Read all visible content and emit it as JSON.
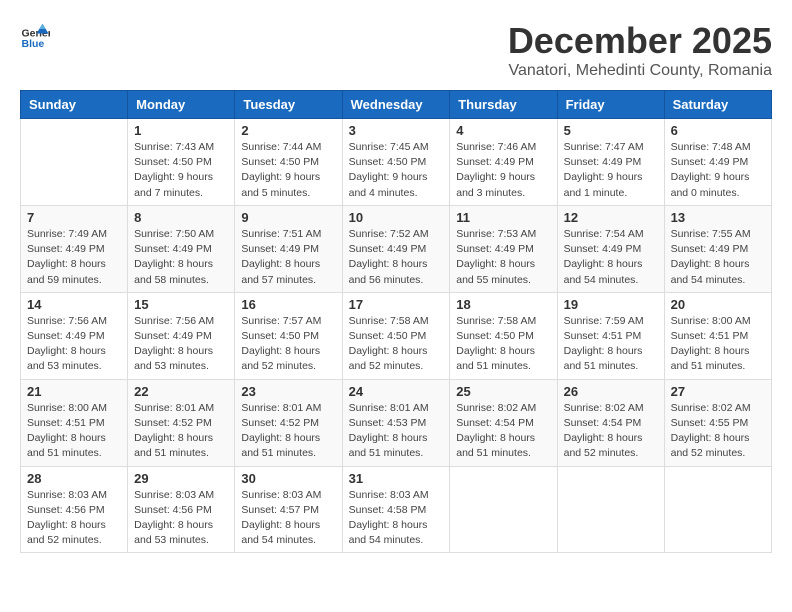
{
  "logo": {
    "general": "General",
    "blue": "Blue"
  },
  "title": {
    "month": "December 2025",
    "location": "Vanatori, Mehedinti County, Romania"
  },
  "days_header": [
    "Sunday",
    "Monday",
    "Tuesday",
    "Wednesday",
    "Thursday",
    "Friday",
    "Saturday"
  ],
  "weeks": [
    [
      {
        "day": "",
        "sunrise": "",
        "sunset": "",
        "daylight": ""
      },
      {
        "day": "1",
        "sunrise": "Sunrise: 7:43 AM",
        "sunset": "Sunset: 4:50 PM",
        "daylight": "Daylight: 9 hours and 7 minutes."
      },
      {
        "day": "2",
        "sunrise": "Sunrise: 7:44 AM",
        "sunset": "Sunset: 4:50 PM",
        "daylight": "Daylight: 9 hours and 5 minutes."
      },
      {
        "day": "3",
        "sunrise": "Sunrise: 7:45 AM",
        "sunset": "Sunset: 4:50 PM",
        "daylight": "Daylight: 9 hours and 4 minutes."
      },
      {
        "day": "4",
        "sunrise": "Sunrise: 7:46 AM",
        "sunset": "Sunset: 4:49 PM",
        "daylight": "Daylight: 9 hours and 3 minutes."
      },
      {
        "day": "5",
        "sunrise": "Sunrise: 7:47 AM",
        "sunset": "Sunset: 4:49 PM",
        "daylight": "Daylight: 9 hours and 1 minute."
      },
      {
        "day": "6",
        "sunrise": "Sunrise: 7:48 AM",
        "sunset": "Sunset: 4:49 PM",
        "daylight": "Daylight: 9 hours and 0 minutes."
      }
    ],
    [
      {
        "day": "7",
        "sunrise": "Sunrise: 7:49 AM",
        "sunset": "Sunset: 4:49 PM",
        "daylight": "Daylight: 8 hours and 59 minutes."
      },
      {
        "day": "8",
        "sunrise": "Sunrise: 7:50 AM",
        "sunset": "Sunset: 4:49 PM",
        "daylight": "Daylight: 8 hours and 58 minutes."
      },
      {
        "day": "9",
        "sunrise": "Sunrise: 7:51 AM",
        "sunset": "Sunset: 4:49 PM",
        "daylight": "Daylight: 8 hours and 57 minutes."
      },
      {
        "day": "10",
        "sunrise": "Sunrise: 7:52 AM",
        "sunset": "Sunset: 4:49 PM",
        "daylight": "Daylight: 8 hours and 56 minutes."
      },
      {
        "day": "11",
        "sunrise": "Sunrise: 7:53 AM",
        "sunset": "Sunset: 4:49 PM",
        "daylight": "Daylight: 8 hours and 55 minutes."
      },
      {
        "day": "12",
        "sunrise": "Sunrise: 7:54 AM",
        "sunset": "Sunset: 4:49 PM",
        "daylight": "Daylight: 8 hours and 54 minutes."
      },
      {
        "day": "13",
        "sunrise": "Sunrise: 7:55 AM",
        "sunset": "Sunset: 4:49 PM",
        "daylight": "Daylight: 8 hours and 54 minutes."
      }
    ],
    [
      {
        "day": "14",
        "sunrise": "Sunrise: 7:56 AM",
        "sunset": "Sunset: 4:49 PM",
        "daylight": "Daylight: 8 hours and 53 minutes."
      },
      {
        "day": "15",
        "sunrise": "Sunrise: 7:56 AM",
        "sunset": "Sunset: 4:49 PM",
        "daylight": "Daylight: 8 hours and 53 minutes."
      },
      {
        "day": "16",
        "sunrise": "Sunrise: 7:57 AM",
        "sunset": "Sunset: 4:50 PM",
        "daylight": "Daylight: 8 hours and 52 minutes."
      },
      {
        "day": "17",
        "sunrise": "Sunrise: 7:58 AM",
        "sunset": "Sunset: 4:50 PM",
        "daylight": "Daylight: 8 hours and 52 minutes."
      },
      {
        "day": "18",
        "sunrise": "Sunrise: 7:58 AM",
        "sunset": "Sunset: 4:50 PM",
        "daylight": "Daylight: 8 hours and 51 minutes."
      },
      {
        "day": "19",
        "sunrise": "Sunrise: 7:59 AM",
        "sunset": "Sunset: 4:51 PM",
        "daylight": "Daylight: 8 hours and 51 minutes."
      },
      {
        "day": "20",
        "sunrise": "Sunrise: 8:00 AM",
        "sunset": "Sunset: 4:51 PM",
        "daylight": "Daylight: 8 hours and 51 minutes."
      }
    ],
    [
      {
        "day": "21",
        "sunrise": "Sunrise: 8:00 AM",
        "sunset": "Sunset: 4:51 PM",
        "daylight": "Daylight: 8 hours and 51 minutes."
      },
      {
        "day": "22",
        "sunrise": "Sunrise: 8:01 AM",
        "sunset": "Sunset: 4:52 PM",
        "daylight": "Daylight: 8 hours and 51 minutes."
      },
      {
        "day": "23",
        "sunrise": "Sunrise: 8:01 AM",
        "sunset": "Sunset: 4:52 PM",
        "daylight": "Daylight: 8 hours and 51 minutes."
      },
      {
        "day": "24",
        "sunrise": "Sunrise: 8:01 AM",
        "sunset": "Sunset: 4:53 PM",
        "daylight": "Daylight: 8 hours and 51 minutes."
      },
      {
        "day": "25",
        "sunrise": "Sunrise: 8:02 AM",
        "sunset": "Sunset: 4:54 PM",
        "daylight": "Daylight: 8 hours and 51 minutes."
      },
      {
        "day": "26",
        "sunrise": "Sunrise: 8:02 AM",
        "sunset": "Sunset: 4:54 PM",
        "daylight": "Daylight: 8 hours and 52 minutes."
      },
      {
        "day": "27",
        "sunrise": "Sunrise: 8:02 AM",
        "sunset": "Sunset: 4:55 PM",
        "daylight": "Daylight: 8 hours and 52 minutes."
      }
    ],
    [
      {
        "day": "28",
        "sunrise": "Sunrise: 8:03 AM",
        "sunset": "Sunset: 4:56 PM",
        "daylight": "Daylight: 8 hours and 52 minutes."
      },
      {
        "day": "29",
        "sunrise": "Sunrise: 8:03 AM",
        "sunset": "Sunset: 4:56 PM",
        "daylight": "Daylight: 8 hours and 53 minutes."
      },
      {
        "day": "30",
        "sunrise": "Sunrise: 8:03 AM",
        "sunset": "Sunset: 4:57 PM",
        "daylight": "Daylight: 8 hours and 54 minutes."
      },
      {
        "day": "31",
        "sunrise": "Sunrise: 8:03 AM",
        "sunset": "Sunset: 4:58 PM",
        "daylight": "Daylight: 8 hours and 54 minutes."
      },
      {
        "day": "",
        "sunrise": "",
        "sunset": "",
        "daylight": ""
      },
      {
        "day": "",
        "sunrise": "",
        "sunset": "",
        "daylight": ""
      },
      {
        "day": "",
        "sunrise": "",
        "sunset": "",
        "daylight": ""
      }
    ]
  ]
}
